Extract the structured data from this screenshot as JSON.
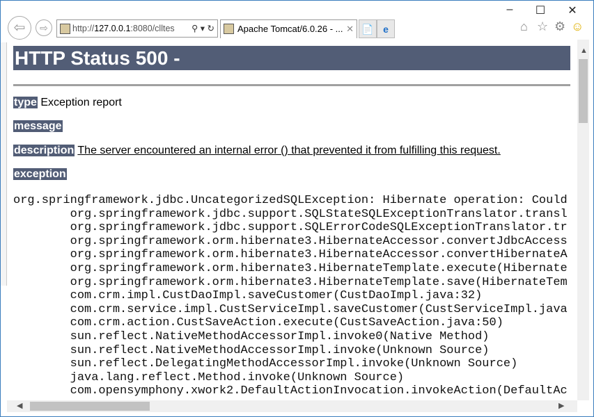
{
  "browser": {
    "address_prefix": "http://",
    "address_host": "127.0.0.1",
    "address_rest": ":8080/clltes",
    "tab_title": "Apache Tomcat/6.0.26 - ...",
    "window_controls": {
      "minimize": "–",
      "maximize": "☐",
      "close": "✕"
    }
  },
  "page": {
    "title": "HTTP Status 500 -",
    "type_label": "type",
    "type_value": "Exception report",
    "message_label": "message",
    "description_label": "description",
    "description_value": "The server encountered an internal error () that prevented it from fulfilling this request.",
    "exception_label": "exception",
    "stack_trace": [
      "org.springframework.jdbc.UncategorizedSQLException: Hibernate operation: Could",
      "\torg.springframework.jdbc.support.SQLStateSQLExceptionTranslator.transl",
      "\torg.springframework.jdbc.support.SQLErrorCodeSQLExceptionTranslator.tr",
      "\torg.springframework.orm.hibernate3.HibernateAccessor.convertJdbcAccess",
      "\torg.springframework.orm.hibernate3.HibernateAccessor.convertHibernateA",
      "\torg.springframework.orm.hibernate3.HibernateTemplate.execute(Hibernate",
      "\torg.springframework.orm.hibernate3.HibernateTemplate.save(HibernateTem",
      "\tcom.crm.impl.CustDaoImpl.saveCustomer(CustDaoImpl.java:32)",
      "\tcom.crm.service.impl.CustServiceImpl.saveCustomer(CustServiceImpl.java",
      "\tcom.crm.action.CustSaveAction.execute(CustSaveAction.java:50)",
      "\tsun.reflect.NativeMethodAccessorImpl.invoke0(Native Method)",
      "\tsun.reflect.NativeMethodAccessorImpl.invoke(Unknown Source)",
      "\tsun.reflect.DelegatingMethodAccessorImpl.invoke(Unknown Source)",
      "\tjava.lang.reflect.Method.invoke(Unknown Source)",
      "\tcom.opensymphony.xwork2.DefaultActionInvocation.invokeAction(DefaultAc"
    ]
  }
}
